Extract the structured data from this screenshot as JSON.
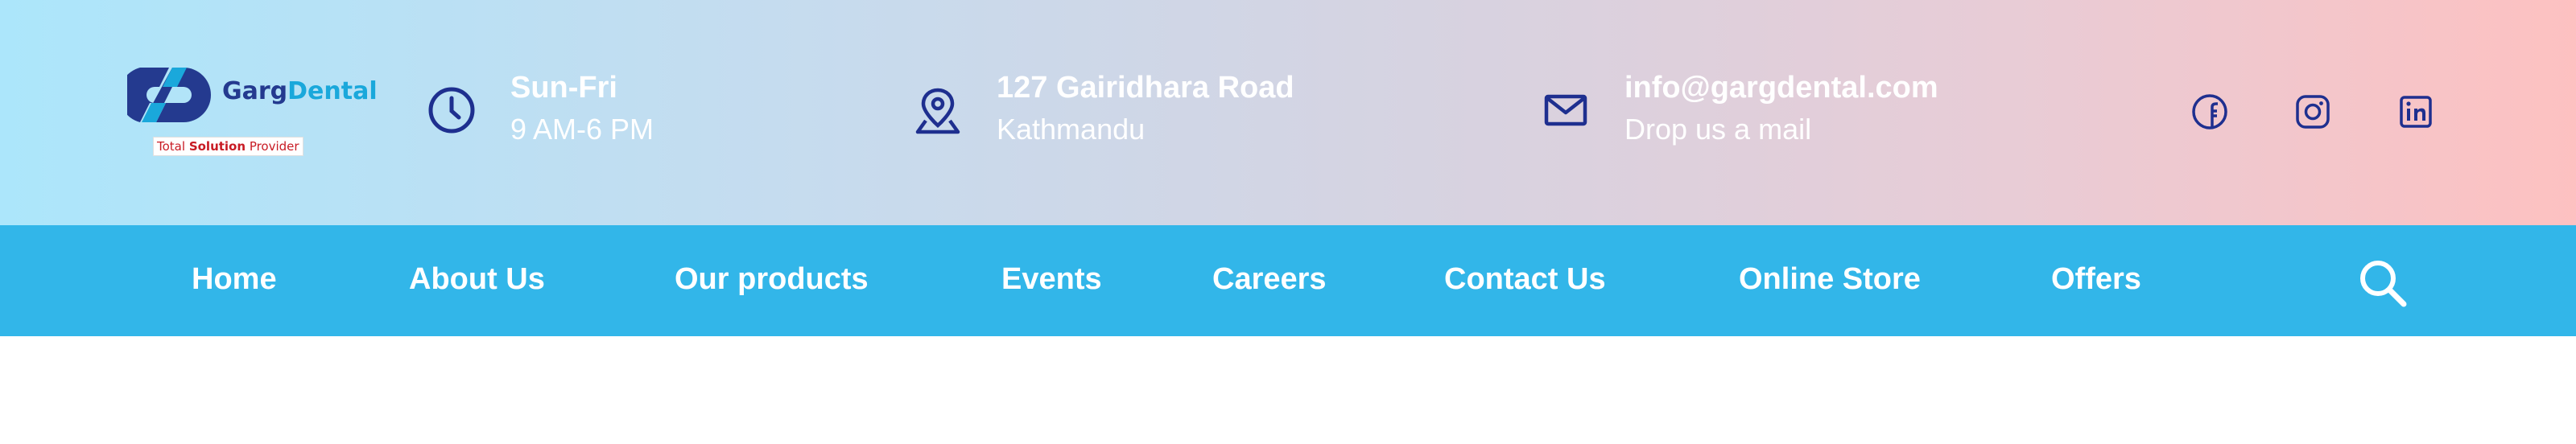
{
  "brand": {
    "name_part1": "Garg",
    "name_part2": "Dental",
    "tagline_before": "Total ",
    "tagline_bold": "Solution",
    "tagline_after": " Provider",
    "colors": {
      "dark_blue": "#243a8f",
      "light_blue": "#1aa8db",
      "tagline_red": "#c81b24"
    }
  },
  "header": {
    "hours": {
      "icon": "clock-icon",
      "title": "Sun-Fri",
      "subtitle": "9 AM-6 PM"
    },
    "address": {
      "icon": "location-pin-icon",
      "title": "127 Gairidhara Road",
      "subtitle": "Kathmandu"
    },
    "email": {
      "icon": "mail-icon",
      "title": "info@gargdental.com",
      "subtitle": "Drop us a mail"
    },
    "social": [
      {
        "icon": "facebook-icon"
      },
      {
        "icon": "instagram-icon"
      },
      {
        "icon": "linkedin-icon"
      }
    ],
    "icon_color": "#1e2f8f",
    "gradient": [
      "#ace6fb",
      "#fdc1c1"
    ]
  },
  "nav": {
    "items": [
      {
        "label": "Home"
      },
      {
        "label": "About Us"
      },
      {
        "label": "Our products"
      },
      {
        "label": "Events"
      },
      {
        "label": "Careers"
      },
      {
        "label": "Contact Us"
      },
      {
        "label": "Online Store"
      },
      {
        "label": "Offers"
      }
    ],
    "search_icon": "search-icon",
    "background": "#32b6e9"
  }
}
